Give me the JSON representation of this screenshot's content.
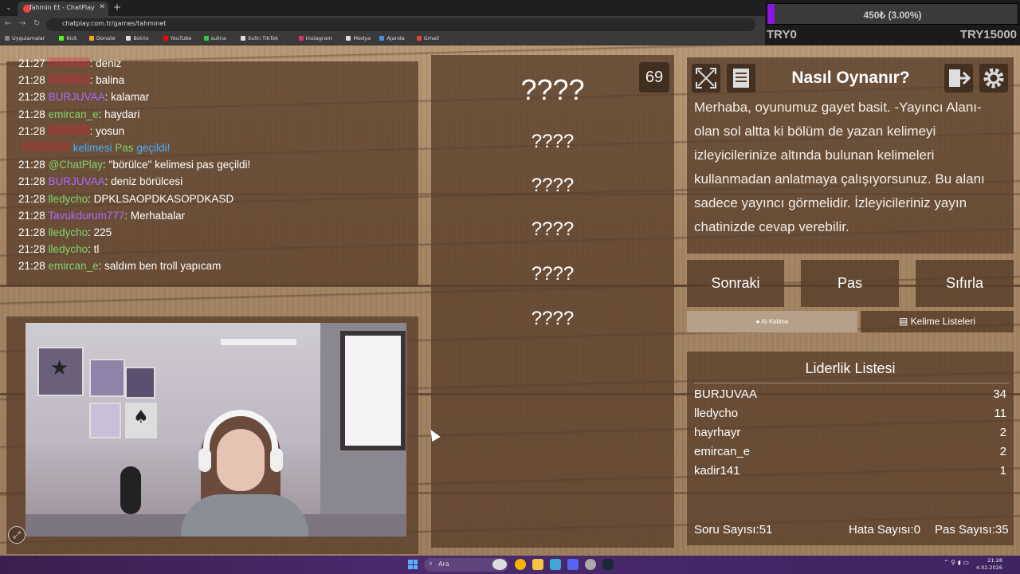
{
  "browser": {
    "tab_title": "Tahmin Et - ChatPlay",
    "url": "chatplay.com.tr/games/tahminet",
    "bookmarks": [
      {
        "label": "Uygulamalar",
        "color": "#888888"
      },
      {
        "label": "Kick",
        "color": "#53fc18"
      },
      {
        "label": "Donate",
        "color": "#f5a623"
      },
      {
        "label": "Botrix",
        "color": "#dddddd"
      },
      {
        "label": "YouTube",
        "color": "#ff0000"
      },
      {
        "label": "sulina",
        "color": "#2ecc40"
      },
      {
        "label": "Sulin TikTok",
        "color": "#dddddd"
      },
      {
        "label": "Instagram",
        "color": "#e1306c"
      },
      {
        "label": "Medya",
        "color": "#dddddd"
      },
      {
        "label": "Ajanda",
        "color": "#4a90e2"
      },
      {
        "label": "Gmail",
        "color": "#ea4335"
      }
    ]
  },
  "donation": {
    "label": "450₺ (3.00%)",
    "progress": 0.03,
    "min_label": "TRY0",
    "max_label": "TRY15000",
    "fill_color": "#8a16e0"
  },
  "chat": [
    {
      "time": "21:27",
      "user": "",
      "user_class": "u-red",
      "msg": ": deniz"
    },
    {
      "time": "21:28",
      "user": "",
      "user_class": "u-red",
      "msg": ": balina"
    },
    {
      "time": "21:28",
      "user": "BURJUVAA",
      "user_class": "u-purple",
      "msg": ": kalamar"
    },
    {
      "time": "21:28",
      "user": "emircan_e",
      "user_class": "u-green",
      "msg": ": haydari"
    },
    {
      "time": "21:28",
      "user": "",
      "user_class": "u-red",
      "msg": ": yosun"
    },
    {
      "time": "",
      "user": "",
      "user_class": "u-red",
      "msg": "",
      "special": true
    },
    {
      "time": "21:28",
      "user": "@ChatPlay",
      "user_class": "u-green",
      "msg": ": \"börülce\" kelimesi pas geçildi!"
    },
    {
      "time": "21:28",
      "user": "BURJUVAA",
      "user_class": "u-purple",
      "msg": ": deniz börülcesi"
    },
    {
      "time": "21:28",
      "user": "lledycho",
      "user_class": "u-green",
      "msg": ": DPKLSAOPDKASOPDKASD"
    },
    {
      "time": "21:28",
      "user": "Tavukdurum777",
      "user_class": "u-purple",
      "msg": ": Merhabalar"
    },
    {
      "time": "21:28",
      "user": "lledycho",
      "user_class": "u-green",
      "msg": ": 225"
    },
    {
      "time": "21:28",
      "user": "lledycho",
      "user_class": "u-green",
      "msg": ": tl"
    },
    {
      "time": "21:28",
      "user": "emircan_e",
      "user_class": "u-green",
      "msg": ": saldım ben troll yapıcam"
    }
  ],
  "chat_special": {
    "part1": "kelimesi",
    "part2": "Pas",
    "part3": "geçildi!"
  },
  "game": {
    "counter": "69",
    "words": [
      "????",
      "????",
      "????",
      "????",
      "????",
      "????"
    ]
  },
  "help": {
    "title": "Nasıl Oynanır?",
    "text": "Merhaba, oyunumuz gayet basit. -Yayıncı Alanı- olan sol altta ki bölüm de yazan kelimeyi izleyicilerinize altında bulunan kelimeleri kullanmadan anlatmaya çalışıyorsunuz. Bu alanı sadece yayıncı görmelidir. İzleyicileriniz yayın chatinizde cevap verebilir."
  },
  "actions": {
    "next": "Sonraki",
    "pass": "Pas",
    "reset": "Sıfırla",
    "ai_word": "AI Kelime",
    "word_lists": "Kelime Listeleri"
  },
  "leaderboard": {
    "title": "Liderlik Listesi",
    "rows": [
      {
        "name": "BURJUVAA",
        "score": "34"
      },
      {
        "name": "lledycho",
        "score": "11"
      },
      {
        "name": "hayrhayr",
        "score": "2"
      },
      {
        "name": "emircan_e",
        "score": "2"
      },
      {
        "name": "kadir141",
        "score": "1"
      }
    ]
  },
  "stats": {
    "questions": "Soru Sayısı:51",
    "errors": "Hata Sayısı:0",
    "passes": "Pas Sayısı:35"
  },
  "taskbar": {
    "search_placeholder": "Ara",
    "time": "21:28",
    "date": "4.02.2026"
  }
}
